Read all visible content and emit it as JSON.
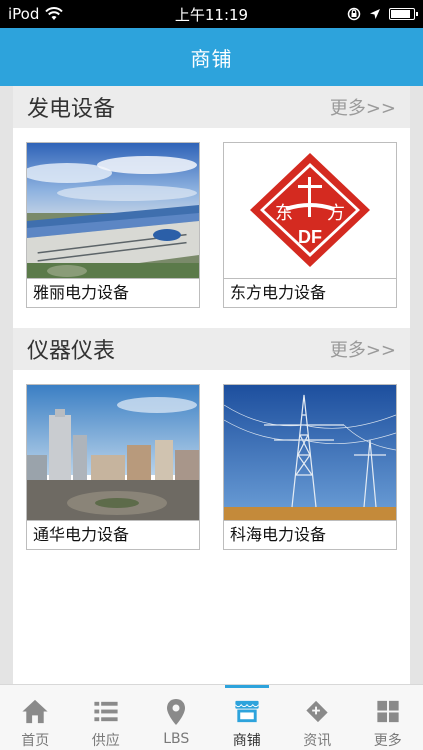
{
  "status_bar": {
    "carrier": "iPod",
    "time": "上午11:19"
  },
  "nav": {
    "title": "商铺"
  },
  "sections": [
    {
      "title": "发电设备",
      "more": "更多>>",
      "items": [
        {
          "label": "雅丽电力设备",
          "image": "factory-photo"
        },
        {
          "label": "东方电力设备",
          "image": "df-logo"
        }
      ]
    },
    {
      "title": "仪器仪表",
      "more": "更多>>",
      "items": [
        {
          "label": "通华电力设备",
          "image": "city-photo"
        },
        {
          "label": "科海电力设备",
          "image": "power-tower-photo"
        }
      ]
    }
  ],
  "logo_text": {
    "east": "东",
    "side": "方",
    "df": "DF"
  },
  "tabs": [
    {
      "label": "首页",
      "icon": "home-icon"
    },
    {
      "label": "供应",
      "icon": "list-icon"
    },
    {
      "label": "LBS",
      "icon": "location-pin-icon"
    },
    {
      "label": "商铺",
      "icon": "shop-icon",
      "active": true
    },
    {
      "label": "资讯",
      "icon": "news-icon"
    },
    {
      "label": "更多",
      "icon": "grid-icon"
    }
  ],
  "colors": {
    "accent": "#2da3dc",
    "logo_red": "#d42a20"
  }
}
